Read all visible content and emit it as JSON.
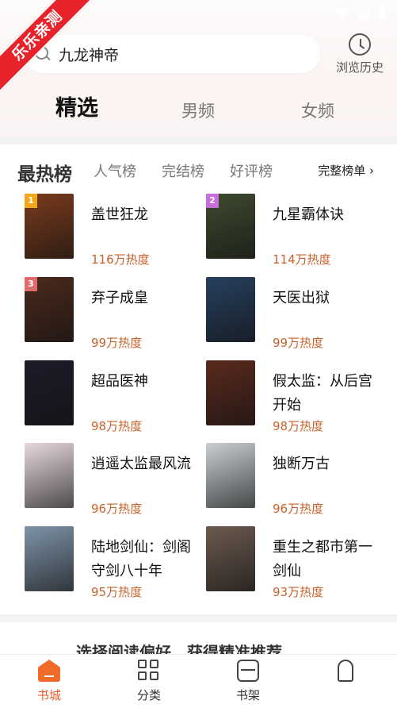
{
  "watermark": "乐乐亲测",
  "header": {
    "search_value": "九龙神帝",
    "history_label": "浏览历史"
  },
  "gender_tabs": [
    "精选",
    "男频",
    "女频"
  ],
  "ranking": {
    "tabs": [
      "最热榜",
      "人气榜",
      "完结榜",
      "好评榜"
    ],
    "full_list": "完整榜单 ›",
    "books": [
      {
        "rank": "1",
        "title": "盖世狂龙",
        "heat": "116万热度",
        "cover_color": "#7a3b1c",
        "badge_color": "#f3a81c"
      },
      {
        "rank": "2",
        "title": "九星霸体诀",
        "heat": "114万热度",
        "cover_color": "#3f4a2f",
        "badge_color": "#c86eda"
      },
      {
        "rank": "3",
        "title": "弃子成皇",
        "heat": "99万热度",
        "cover_color": "#4b2a1d",
        "badge_color": "#e26a6a"
      },
      {
        "rank": "",
        "title": "天医出狱",
        "heat": "99万热度",
        "cover_color": "#27405e",
        "badge_color": ""
      },
      {
        "rank": "",
        "title": "超品医神",
        "heat": "98万热度",
        "cover_color": "#1c1c2a",
        "badge_color": ""
      },
      {
        "rank": "",
        "title": "假太监：从后宫开始",
        "heat": "98万热度",
        "cover_color": "#5a2a1e",
        "badge_color": ""
      },
      {
        "rank": "",
        "title": "逍遥太监最风流",
        "heat": "96万热度",
        "cover_color": "#e7d9dd",
        "badge_color": ""
      },
      {
        "rank": "",
        "title": "独断万古",
        "heat": "96万热度",
        "cover_color": "#c9cfd2",
        "badge_color": ""
      },
      {
        "rank": "",
        "title": "陆地剑仙：剑阁守剑八十年",
        "heat": "95万热度",
        "cover_color": "#7e93a8",
        "badge_color": ""
      },
      {
        "rank": "",
        "title": "重生之都市第一剑仙",
        "heat": "93万热度",
        "cover_color": "#6c5a4f",
        "badge_color": ""
      }
    ]
  },
  "promo_text": "选择阅读偏好，获得精准推荐",
  "bottom_nav": [
    {
      "label": "书城",
      "icon": "home-icon"
    },
    {
      "label": "分类",
      "icon": "grid-icon"
    },
    {
      "label": "书架",
      "icon": "bookshelf-icon"
    },
    {
      "label": "",
      "icon": "profile-icon"
    }
  ],
  "colors": {
    "accent": "#e85a2a",
    "heat": "#c8622c",
    "ribbon": "#e8222a"
  }
}
